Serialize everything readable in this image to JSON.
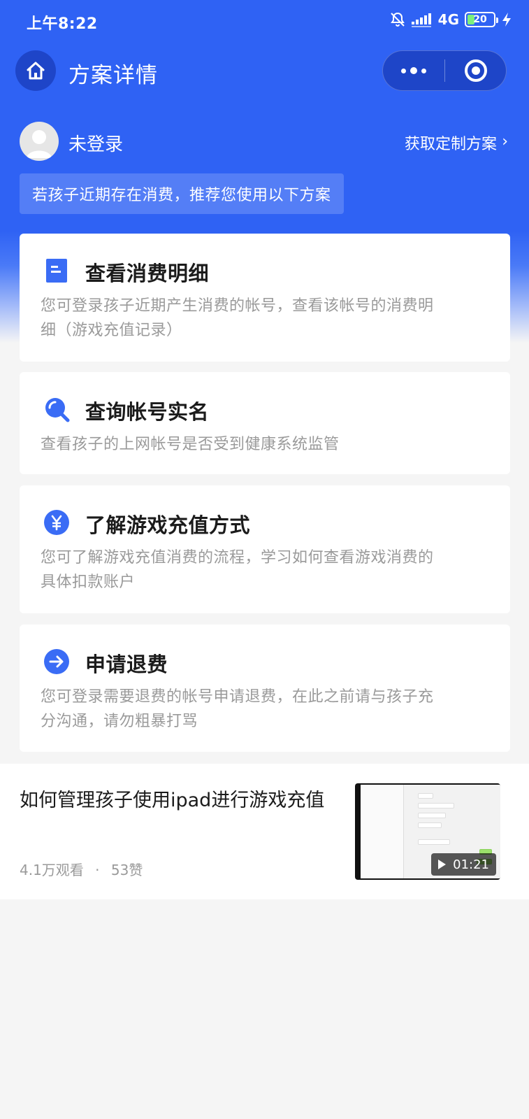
{
  "status_bar": {
    "time": "上午8:22",
    "network": "4G",
    "battery": "20"
  },
  "nav": {
    "title": "方案详情"
  },
  "user": {
    "name": "未登录",
    "get_plan_label": "获取定制方案",
    "get_plan_chevron": "›"
  },
  "notice": "若孩子近期存在消费，推荐您使用以下方案",
  "cards": [
    {
      "icon": "document-icon",
      "title": "查看消费明细",
      "desc_line1": "您可登录孩子近期产生消费的帐号，查看该帐号的消费明",
      "desc_line2": "细（游戏充值记录）"
    },
    {
      "icon": "search-icon",
      "title": "查询帐号实名",
      "desc_line1": "查看孩子的上网帐号是否受到健康系统监管"
    },
    {
      "icon": "yuan-icon",
      "title": "了解游戏充值方式",
      "desc_line1": "您可了解游戏充值消费的流程，学习如何查看游戏消费的",
      "desc_line2": "具体扣款账户"
    },
    {
      "icon": "arrow-right-icon",
      "title": "申请退费",
      "desc_line1": "您可登录需要退费的帐号申请退费，在此之前请与孩子充",
      "desc_line2": "分沟通，请勿粗暴打骂"
    }
  ],
  "video": {
    "title": "如何管理孩子使用ipad进行游戏充值",
    "views": "4.1万观看",
    "separator": "·",
    "likes": "53赞",
    "duration": "01:21"
  },
  "colors": {
    "brand_blue": "#2f62f4",
    "capsule_blue": "#1e45c8",
    "muted_text": "#9a9a9a"
  }
}
